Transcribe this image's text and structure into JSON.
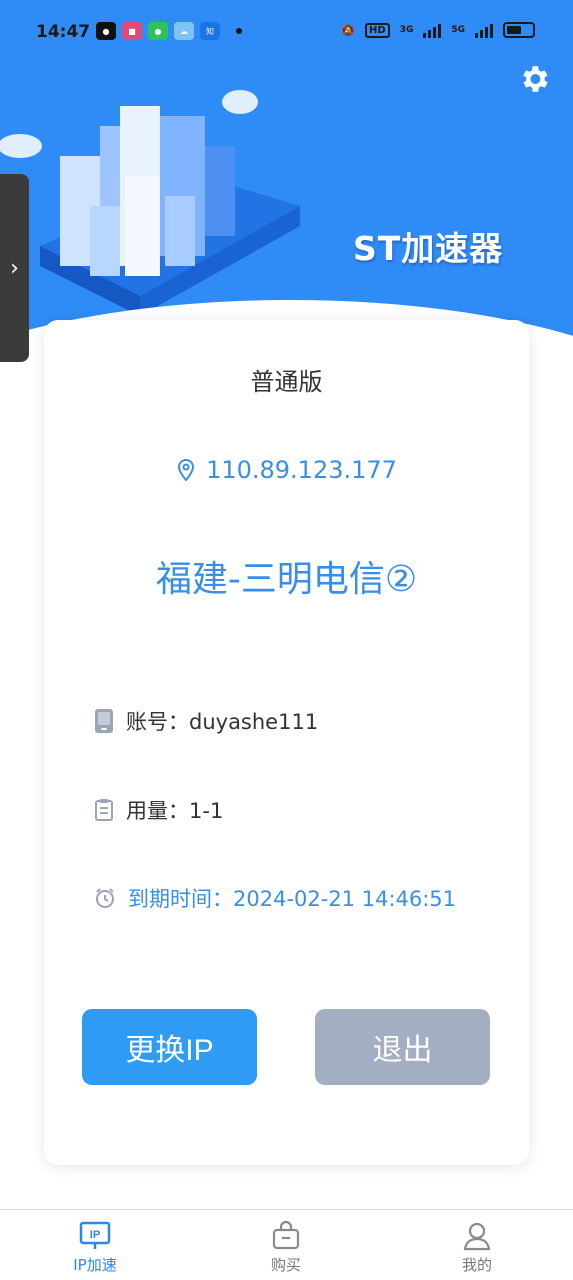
{
  "status_bar": {
    "time": "14:47",
    "network_1": "3G",
    "network_2": "5G",
    "hd_badge": "HD"
  },
  "header": {
    "brand_title": "ST加速器",
    "settings_icon": "gear-icon",
    "accent_color": "#2f8bf5"
  },
  "card": {
    "plan_label": "普通版",
    "ip_address": "110.89.123.177",
    "location": "福建-三明电信②",
    "account_label": "账号：duyashe111",
    "usage_label": "用量：1-1",
    "expire_label": "到期时间：2024-02-21 14:46:51",
    "change_ip_button": "更换IP",
    "logout_button": "退出"
  },
  "bottom_nav": {
    "items": [
      {
        "label": "IP加速",
        "icon": "ip-icon",
        "active": true
      },
      {
        "label": "购买",
        "icon": "bag-icon",
        "active": false
      },
      {
        "label": "我的",
        "icon": "user-icon",
        "active": false
      }
    ]
  },
  "colors": {
    "primary": "#2f9bf5",
    "text_blue": "#3a8ee6",
    "disabled_gray": "#a3aec2"
  }
}
